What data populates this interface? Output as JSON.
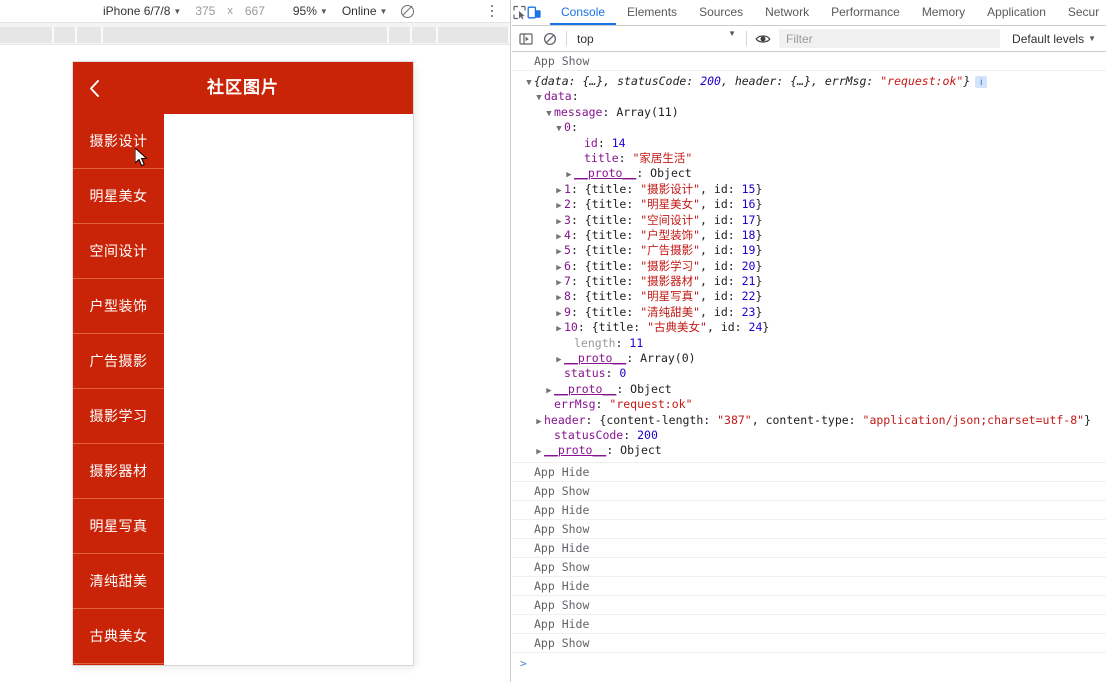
{
  "device_toolbar": {
    "device_label": "iPhone 6/7/8",
    "width": "375",
    "x_separator": "x",
    "height": "667",
    "zoom": "95%",
    "network": "Online",
    "throttle_icon": "no-throttling-icon",
    "more_icon": "kebab-menu-icon"
  },
  "phone": {
    "header": {
      "back_icon": "chevron-left-icon",
      "title": "社区图片"
    },
    "categories": [
      {
        "label": "摄影设计",
        "active": true
      },
      {
        "label": "明星美女",
        "active": false
      },
      {
        "label": "空间设计",
        "active": false
      },
      {
        "label": "户型装饰",
        "active": false
      },
      {
        "label": "广告摄影",
        "active": false
      },
      {
        "label": "摄影学习",
        "active": false
      },
      {
        "label": "摄影器材",
        "active": false
      },
      {
        "label": "明星写真",
        "active": false
      },
      {
        "label": "清纯甜美",
        "active": false
      },
      {
        "label": "古典美女",
        "active": false
      }
    ],
    "accent_color": "#c92408",
    "divider_color": "#e0603f"
  },
  "devtools": {
    "toolbar_icons": {
      "inspect": "inspect-element-icon",
      "device": "toggle-device-toolbar-icon"
    },
    "tabs": [
      {
        "label": "Console",
        "active": true
      },
      {
        "label": "Elements",
        "active": false
      },
      {
        "label": "Sources",
        "active": false
      },
      {
        "label": "Network",
        "active": false
      },
      {
        "label": "Performance",
        "active": false
      },
      {
        "label": "Memory",
        "active": false
      },
      {
        "label": "Application",
        "active": false
      },
      {
        "label": "Secur",
        "active": false
      }
    ],
    "filterbar": {
      "sidebar_icon": "console-sidebar-icon",
      "clear_icon": "clear-console-icon",
      "context": "top",
      "eye_icon": "live-expression-icon",
      "filter_placeholder": "Filter",
      "levels": "Default levels"
    },
    "console": {
      "top_message": "App Show",
      "object_summary": {
        "prefix": "{data: ",
        "data_collapsed": "{…}",
        "sep1": ", statusCode: ",
        "status_code": "200",
        "sep2": ", header: ",
        "header_collapsed": "{…}",
        "sep3": ", errMsg: ",
        "err_msg": "\"request:ok\"",
        "suffix": "}",
        "badge": "i"
      },
      "tree": [
        {
          "indent": 1,
          "arrow": "open",
          "key": "data",
          "keyclass": "name",
          "sep": ":",
          "value": "",
          "valclass": ""
        },
        {
          "indent": 2,
          "arrow": "open",
          "key": "message",
          "keyclass": "name",
          "sep": ": ",
          "value": "Array(11)",
          "valclass": "plain"
        },
        {
          "indent": 3,
          "arrow": "open",
          "key": "0",
          "keyclass": "name",
          "sep": ":",
          "value": "",
          "valclass": ""
        },
        {
          "indent": 5,
          "arrow": "blank",
          "key": "id",
          "keyclass": "name",
          "sep": ": ",
          "value": "14",
          "valclass": "num"
        },
        {
          "indent": 5,
          "arrow": "blank",
          "key": "title",
          "keyclass": "name",
          "sep": ": ",
          "value": "\"家居生活\"",
          "valclass": "str"
        },
        {
          "indent": 4,
          "arrow": "closed",
          "key": "__proto__",
          "keyclass": "proto",
          "sep": ": ",
          "value": "Object",
          "valclass": "plain"
        },
        {
          "indent": 3,
          "arrow": "closed",
          "key": "1",
          "keyclass": "name",
          "sep": ": ",
          "value": "{title: \"摄影设计\", id: 15}",
          "valclass": "mixed",
          "title": "摄影设计",
          "id": "15"
        },
        {
          "indent": 3,
          "arrow": "closed",
          "key": "2",
          "keyclass": "name",
          "sep": ": ",
          "value": "{title: \"明星美女\", id: 16}",
          "valclass": "mixed",
          "title": "明星美女",
          "id": "16"
        },
        {
          "indent": 3,
          "arrow": "closed",
          "key": "3",
          "keyclass": "name",
          "sep": ": ",
          "value": "{title: \"空间设计\", id: 17}",
          "valclass": "mixed",
          "title": "空间设计",
          "id": "17"
        },
        {
          "indent": 3,
          "arrow": "closed",
          "key": "4",
          "keyclass": "name",
          "sep": ": ",
          "value": "{title: \"户型装饰\", id: 18}",
          "valclass": "mixed",
          "title": "户型装饰",
          "id": "18"
        },
        {
          "indent": 3,
          "arrow": "closed",
          "key": "5",
          "keyclass": "name",
          "sep": ": ",
          "value": "{title: \"广告摄影\", id: 19}",
          "valclass": "mixed",
          "title": "广告摄影",
          "id": "19"
        },
        {
          "indent": 3,
          "arrow": "closed",
          "key": "6",
          "keyclass": "name",
          "sep": ": ",
          "value": "{title: \"摄影学习\", id: 20}",
          "valclass": "mixed",
          "title": "摄影学习",
          "id": "20"
        },
        {
          "indent": 3,
          "arrow": "closed",
          "key": "7",
          "keyclass": "name",
          "sep": ": ",
          "value": "{title: \"摄影器材\", id: 21}",
          "valclass": "mixed",
          "title": "摄影器材",
          "id": "21"
        },
        {
          "indent": 3,
          "arrow": "closed",
          "key": "8",
          "keyclass": "name",
          "sep": ": ",
          "value": "{title: \"明星写真\", id: 22}",
          "valclass": "mixed",
          "title": "明星写真",
          "id": "22"
        },
        {
          "indent": 3,
          "arrow": "closed",
          "key": "9",
          "keyclass": "name",
          "sep": ": ",
          "value": "{title: \"清纯甜美\", id: 23}",
          "valclass": "mixed",
          "title": "清纯甜美",
          "id": "23"
        },
        {
          "indent": 3,
          "arrow": "closed",
          "key": "10",
          "keyclass": "name",
          "sep": ": ",
          "value": "{title: \"古典美女\", id: 24}",
          "valclass": "mixed",
          "title": "古典美女",
          "id": "24"
        },
        {
          "indent": 4,
          "arrow": "blank",
          "key": "length",
          "keyclass": "grey",
          "sep": ": ",
          "value": "11",
          "valclass": "num"
        },
        {
          "indent": 3,
          "arrow": "closed",
          "key": "__proto__",
          "keyclass": "proto",
          "sep": ": ",
          "value": "Array(0)",
          "valclass": "plain"
        },
        {
          "indent": 3,
          "arrow": "blank",
          "key": "status",
          "keyclass": "name",
          "sep": ": ",
          "value": "0",
          "valclass": "num"
        },
        {
          "indent": 2,
          "arrow": "closed",
          "key": "__proto__",
          "keyclass": "proto",
          "sep": ": ",
          "value": "Object",
          "valclass": "plain"
        },
        {
          "indent": 2,
          "arrow": "blank",
          "key": "errMsg",
          "keyclass": "name",
          "sep": ": ",
          "value": "\"request:ok\"",
          "valclass": "str"
        },
        {
          "indent": 1,
          "arrow": "closed",
          "key": "header",
          "keyclass": "name",
          "sep": ": ",
          "value": "{content-length: \"387\", content-type: \"application/json;charset=utf-8\"}",
          "valclass": "header"
        },
        {
          "indent": 2,
          "arrow": "blank",
          "key": "statusCode",
          "keyclass": "name",
          "sep": ": ",
          "value": "200",
          "valclass": "num"
        },
        {
          "indent": 1,
          "arrow": "closed",
          "key": "__proto__",
          "keyclass": "proto",
          "sep": ": ",
          "value": "Object",
          "valclass": "plain"
        }
      ],
      "log_rows": [
        "App Hide",
        "App Show",
        "App Hide",
        "App Show",
        "App Hide",
        "App Show",
        "App Hide",
        "App Show",
        "App Hide",
        "App Show"
      ],
      "prompt_symbol": ">"
    }
  }
}
